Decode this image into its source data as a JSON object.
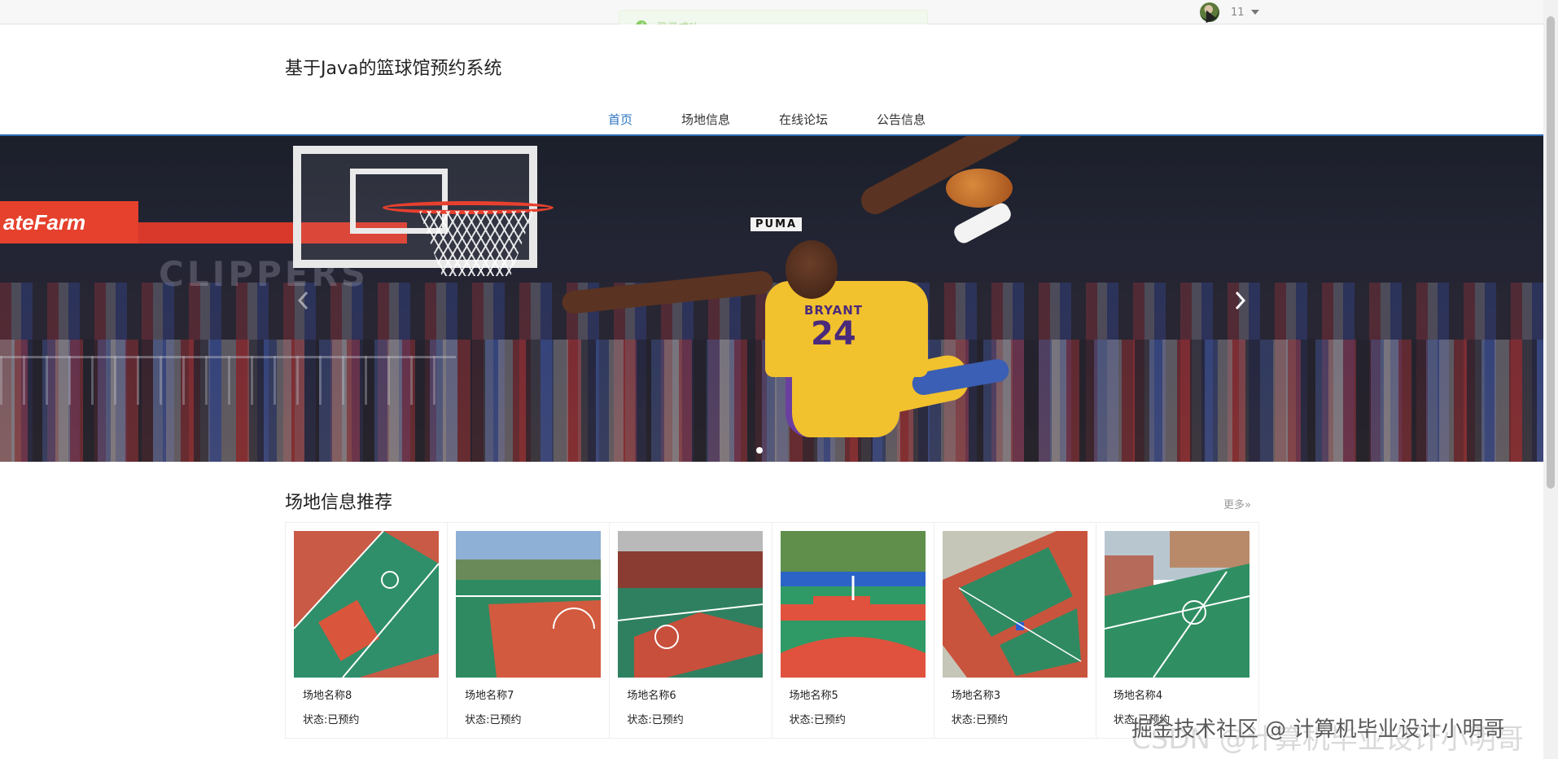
{
  "toast": {
    "message": "登录成功"
  },
  "user": {
    "name": "11"
  },
  "header": {
    "site_title": "基于Java的篮球馆预约系统"
  },
  "nav": {
    "items": [
      {
        "label": "首页",
        "active": true
      },
      {
        "label": "场地信息",
        "active": false
      },
      {
        "label": "在线论坛",
        "active": false
      },
      {
        "label": "公告信息",
        "active": false
      }
    ]
  },
  "banner": {
    "sponsor_text": "ateFarm",
    "clip_text": "CLIPPERS",
    "puma_text": "PUMA",
    "jersey_name": "BRYANT",
    "jersey_number": "24",
    "slide_count": 1,
    "current_slide": 1
  },
  "section": {
    "title": "场地信息推荐",
    "more_label": "更多»",
    "cards": [
      {
        "name": "场地名称8",
        "status": "状态:已预约"
      },
      {
        "name": "场地名称7",
        "status": "状态:已预约"
      },
      {
        "name": "场地名称6",
        "status": "状态:已预约"
      },
      {
        "name": "场地名称5",
        "status": "状态:已预约"
      },
      {
        "name": "场地名称3",
        "status": "状态:已预约"
      },
      {
        "name": "场地名称4",
        "status": "状态:已预约"
      }
    ]
  },
  "watermark": {
    "text": "掘金技术社区 @ 计算机毕业设计小明哥",
    "text2": "CSDN @计算机毕业设计小明哥"
  },
  "colors": {
    "accent": "#2d74c4",
    "court_red": "#d9563c",
    "court_green": "#2e8f64"
  }
}
